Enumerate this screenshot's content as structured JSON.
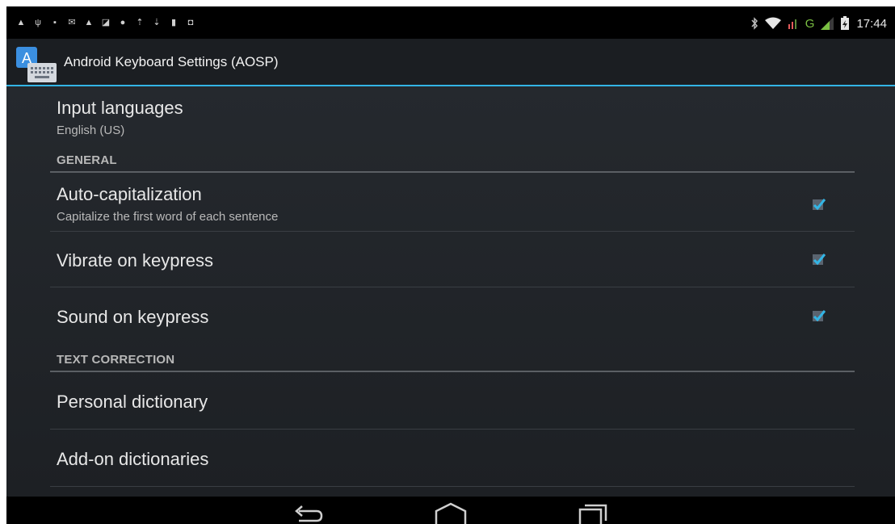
{
  "status_bar": {
    "notification_icons": [
      "warning-icon",
      "usb-icon",
      "lock-icon",
      "gmail-icon",
      "warning-icon",
      "image-icon",
      "sync-icon",
      "upload-icon",
      "download-icon",
      "sd-card-icon",
      "store-icon"
    ],
    "clock": "17:44",
    "network_label": "G"
  },
  "action_bar": {
    "title": "Android Keyboard Settings (AOSP)",
    "icon_letter": "A"
  },
  "preferences": {
    "input_languages": {
      "title": "Input languages",
      "summary": "English (US)"
    },
    "general_header": "GENERAL",
    "auto_capitalization": {
      "title": "Auto-capitalization",
      "summary": "Capitalize the first word of each sentence",
      "checked": true
    },
    "vibrate_on_keypress": {
      "title": "Vibrate on keypress",
      "checked": true
    },
    "sound_on_keypress": {
      "title": "Sound on keypress",
      "checked": true
    },
    "text_correction_header": "TEXT CORRECTION",
    "personal_dictionary": {
      "title": "Personal dictionary"
    },
    "addon_dictionaries": {
      "title": "Add-on dictionaries"
    }
  },
  "nav_bar": {
    "buttons": [
      "back-icon",
      "home-icon",
      "recent-apps-icon"
    ]
  },
  "colors": {
    "accent": "#33b5e5",
    "background": "#25292e",
    "text_primary": "#e8e8e8",
    "text_secondary": "#b9b9b9"
  }
}
